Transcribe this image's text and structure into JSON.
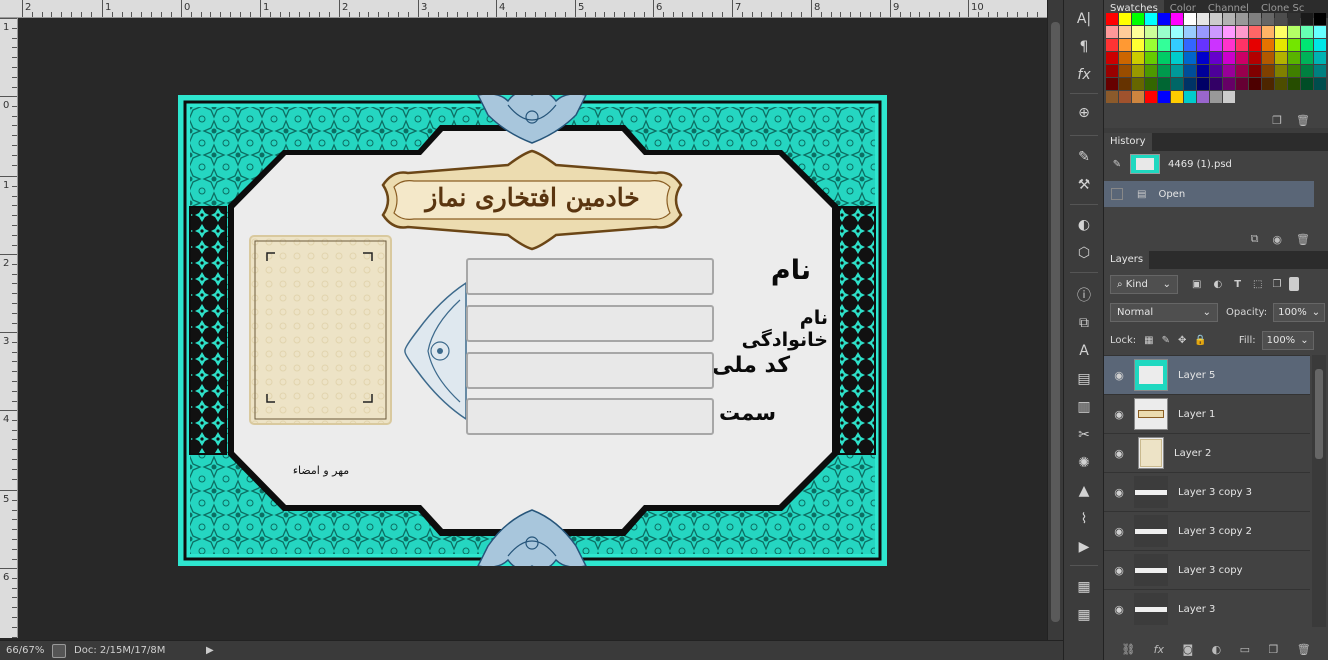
{
  "status": {
    "zoom": "66/67%",
    "doc": "Doc: 2/15M/17/8M"
  },
  "ruler": {
    "top_labels": [
      "2",
      "1",
      "0",
      "1",
      "2",
      "3",
      "4",
      "5",
      "6",
      "7",
      "8",
      "9",
      "10"
    ],
    "left_labels": [
      "1",
      "0",
      "1",
      "2",
      "3",
      "4",
      "5",
      "6"
    ]
  },
  "document": {
    "title": "خادمین افتخاری نماز",
    "fields": [
      {
        "label": "نام"
      },
      {
        "label": "نام خانوادگی"
      },
      {
        "label": "کد ملی"
      },
      {
        "label": "سمت"
      }
    ],
    "stamp_label": "مهر و امضاء"
  },
  "panels": {
    "top_tabs": [
      "Swatches",
      "Color",
      "Channel",
      "Clone Sc"
    ],
    "history": {
      "tab": "History",
      "snapshot": "4469 (1).psd",
      "step": "Open"
    },
    "layers": {
      "tab": "Layers",
      "filter_kind": "Kind",
      "blend_mode": "Normal",
      "opacity_label": "Opacity:",
      "opacity": "100%",
      "lock_label": "Lock:",
      "fill_label": "Fill:",
      "fill": "100%",
      "items": [
        "Layer 5",
        "Layer 1",
        "Layer 2",
        "Layer 3 copy 3",
        "Layer 3 copy 2",
        "Layer 3 copy",
        "Layer 3"
      ]
    }
  },
  "swatch_colors": [
    "#ff0000",
    "#ffff00",
    "#00ff00",
    "#00ffff",
    "#0000ff",
    "#ff00ff",
    "#ffffff",
    "#e6e6e6",
    "#cccccc",
    "#b3b3b3",
    "#999999",
    "#808080",
    "#666666",
    "#4d4d4d",
    "#333333",
    "#1a1a1a",
    "#000000",
    "#ff9999",
    "#ffcc99",
    "#ffff99",
    "#ccff99",
    "#99ffcc",
    "#99ffff",
    "#99ccff",
    "#9999ff",
    "#cc99ff",
    "#ff99ff",
    "#ff99cc",
    "#ff6666",
    "#ffb366",
    "#ffff66",
    "#b3ff66",
    "#66ffb3",
    "#66ffff",
    "#ff3333",
    "#ff9933",
    "#ffff33",
    "#99ff33",
    "#33ff99",
    "#33ccff",
    "#3366ff",
    "#6633ff",
    "#cc33ff",
    "#ff33cc",
    "#ff3366",
    "#e60000",
    "#e67300",
    "#e6e600",
    "#73e600",
    "#00e673",
    "#00e6e6",
    "#cc0000",
    "#cc6600",
    "#cccc00",
    "#66cc00",
    "#00cc66",
    "#00cccc",
    "#0066cc",
    "#0000cc",
    "#6600cc",
    "#cc00cc",
    "#cc0066",
    "#b30000",
    "#b35900",
    "#b3b300",
    "#59b300",
    "#00b359",
    "#00b3b3",
    "#990000",
    "#994d00",
    "#999900",
    "#4d9900",
    "#00994d",
    "#009999",
    "#004d99",
    "#000099",
    "#4d0099",
    "#990099",
    "#99004d",
    "#800000",
    "#804000",
    "#808000",
    "#408000",
    "#008040",
    "#008080",
    "#660000",
    "#663300",
    "#666600",
    "#336600",
    "#006633",
    "#006666",
    "#003366",
    "#000066",
    "#330066",
    "#660066",
    "#660033",
    "#4d0000",
    "#4d2600",
    "#4d4d00",
    "#264d00",
    "#004d26",
    "#004d4d",
    "#8b5a2b",
    "#a0522d",
    "#cd853f",
    "#ff0000",
    "#0000ff",
    "#ffcc00",
    "#00cccc",
    "#9966cc",
    "#999999",
    "#cccccc"
  ]
}
